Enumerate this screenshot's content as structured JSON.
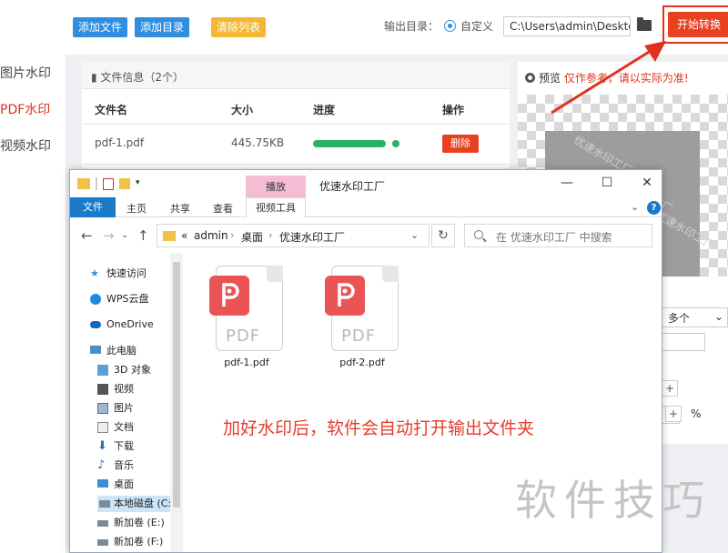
{
  "app": {
    "left_nav": [
      "图片水印",
      "PDF水印",
      "视频水印"
    ],
    "toolbar": {
      "add_file": "添加文件",
      "add_dir": "添加目录",
      "clear_list": "清除列表",
      "output_label": "输出目录：",
      "custom": "自定义",
      "output_path": "C:\\Users\\admin\\Deskto",
      "start": "开始转换"
    },
    "file_panel": {
      "header": "文件信息（2个）",
      "columns": [
        "文件名",
        "大小",
        "进度",
        "操作"
      ],
      "rows": [
        {
          "name": "pdf-1.pdf",
          "size": "445.75KB",
          "progress": 1.0,
          "action": "删除"
        }
      ]
    },
    "preview": {
      "label": "预览",
      "note": "仅作参考，请以实际为准!",
      "watermark_text": "优速水印工厂",
      "select_value": "多个",
      "unit": "%"
    }
  },
  "explorer": {
    "ribbon_context": "播放",
    "title": "优速水印工厂",
    "tabs": [
      "文件",
      "主页",
      "共享",
      "查看",
      "视频工具"
    ],
    "breadcrumb": [
      "«",
      "admin",
      "桌面",
      "优速水印工厂"
    ],
    "search_placeholder": "在 优速水印工厂 中搜索",
    "sidebar": [
      {
        "label": "快速访问",
        "icon": "star-icon"
      },
      {
        "label": "WPS云盘",
        "icon": "cloud-icon"
      },
      {
        "label": "OneDrive",
        "icon": "onedrive-icon"
      },
      {
        "label": "此电脑",
        "icon": "computer-icon"
      },
      {
        "label": "3D 对象",
        "icon": "cube-icon"
      },
      {
        "label": "视频",
        "icon": "video-icon"
      },
      {
        "label": "图片",
        "icon": "image-icon"
      },
      {
        "label": "文档",
        "icon": "document-icon"
      },
      {
        "label": "下载",
        "icon": "download-icon"
      },
      {
        "label": "音乐",
        "icon": "music-icon"
      },
      {
        "label": "桌面",
        "icon": "desktop-icon"
      },
      {
        "label": "本地磁盘 (C:)",
        "icon": "drive-icon"
      },
      {
        "label": "新加卷 (E:)",
        "icon": "drive-icon"
      },
      {
        "label": "新加卷 (F:)",
        "icon": "drive-icon"
      }
    ],
    "files": [
      {
        "name": "pdf-1.pdf",
        "type": "PDF"
      },
      {
        "name": "pdf-2.pdf",
        "type": "PDF"
      }
    ],
    "note": "加好水印后，软件会自动打开输出文件夹"
  },
  "overlay": {
    "watermark": "软件技巧"
  }
}
